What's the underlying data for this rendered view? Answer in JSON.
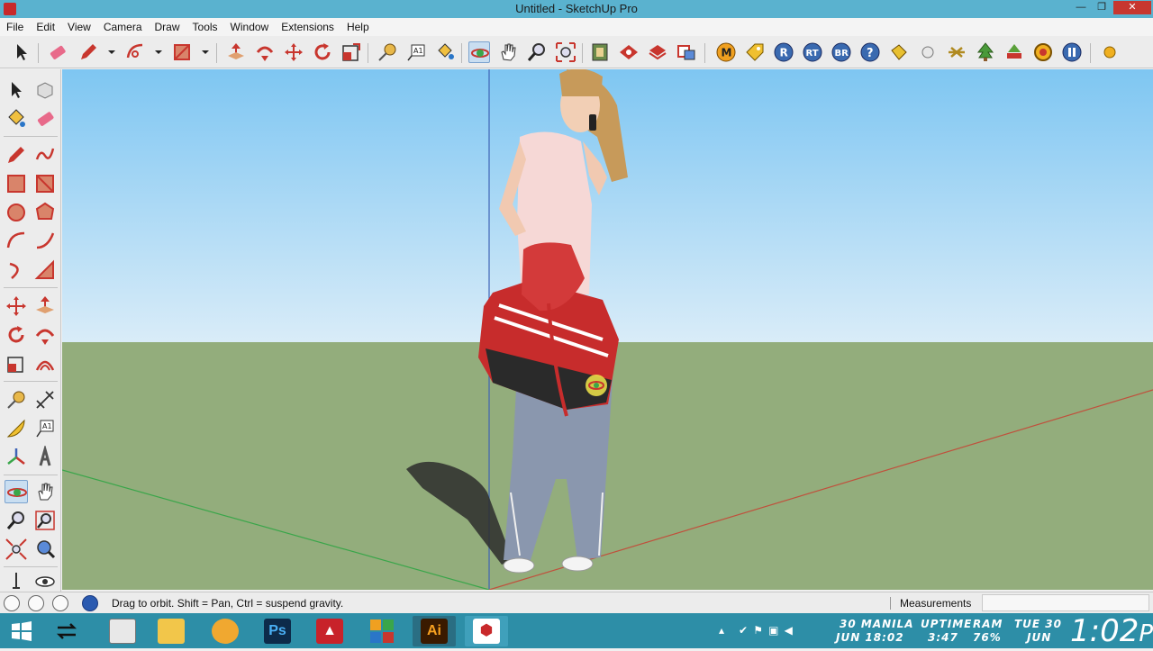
{
  "window": {
    "title": "Untitled - SketchUp Pro",
    "minimize": "—",
    "maximize": "❐",
    "close": "✕"
  },
  "menu": [
    "File",
    "Edit",
    "View",
    "Camera",
    "Draw",
    "Tools",
    "Window",
    "Extensions",
    "Help"
  ],
  "toolbar_icons": [
    "select-icon",
    "eraser-icon",
    "pencil-icon",
    "arc-icon",
    "rectangle-icon",
    "push-pull-icon",
    "follow-me-icon",
    "move-icon",
    "rotate-icon",
    "scale-icon",
    "tape-measure-icon",
    "text-icon",
    "paint-bucket-icon",
    "orbit-icon",
    "pan-icon",
    "zoom-icon",
    "zoom-extents-icon",
    "3d-warehouse-icon",
    "extension-warehouse-icon",
    "layout-icon",
    "style-icon",
    "extension-m-icon",
    "extension-tag-icon",
    "extension-r-icon",
    "extension-rt-icon",
    "extension-br-icon",
    "help-icon",
    "extension-label-icon",
    "sphere-icon",
    "extension-cross-icon",
    "extension-tree-icon",
    "extension-tree2-icon",
    "extension-gear-icon",
    "extension-pause-icon",
    "extension-dot-icon"
  ],
  "status": {
    "message": "Drag to orbit. Shift = Pan, Ctrl = suspend gravity.",
    "measurements_label": "Measurements",
    "measurements_value": ""
  },
  "tray": {
    "date_line1": "30  MANILA",
    "date_line2": "JUN  18:02",
    "uptime_line1": "UPTIME",
    "uptime_line2": "3:47",
    "ram_line1": "RAM",
    "ram_line2": "76%",
    "day_line1": "TUE  30",
    "day_line2": "JUN",
    "time": "1:02",
    "ampm": "PM"
  },
  "taskbar_apps": [
    "start-icon",
    "task-switcher-icon",
    "notepad-icon",
    "file-explorer-icon",
    "pen-tool-icon",
    "photoshop-icon",
    "autocad-icon",
    "metro-apps-icon",
    "illustrator-icon",
    "sketchup-icon"
  ],
  "taskbar_labels": {
    "photoshop": "Ps",
    "illustrator": "Ai"
  },
  "colors": {
    "sky_top": "#7ec6f2",
    "sky_bottom": "#d9ecf8",
    "ground": "#93ad7c",
    "red_axis": "#c0503c",
    "green_axis": "#3aa64a",
    "blue_axis": "#3e63b6",
    "titlebar": "#5ab2cf",
    "taskbar": "#2d8ea7"
  }
}
